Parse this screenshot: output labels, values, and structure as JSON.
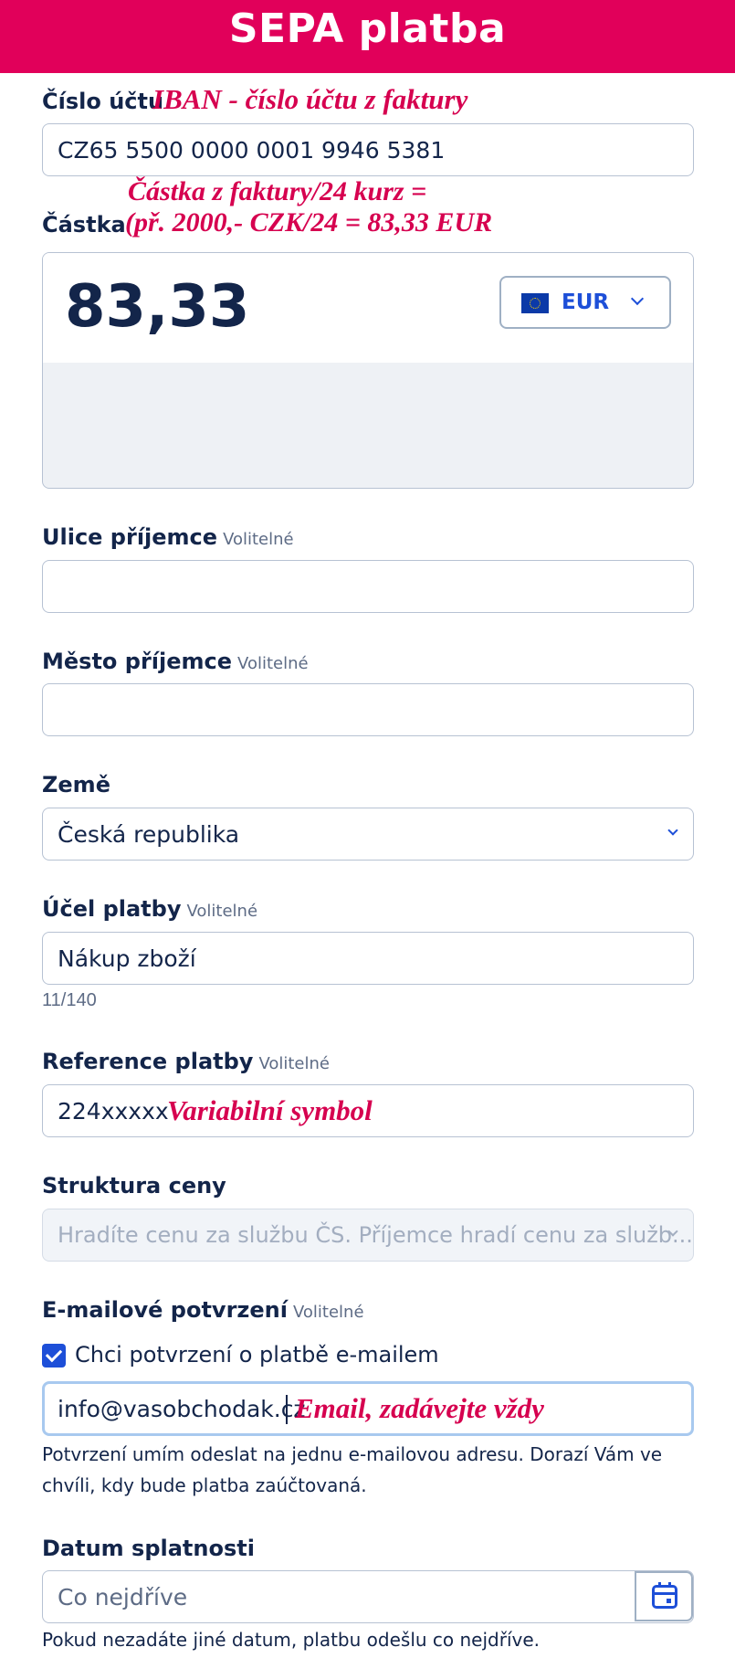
{
  "header": {
    "title": "SEPA platba"
  },
  "account": {
    "label": "Číslo účtu",
    "note": "IBAN - číslo účtu z faktury",
    "value": "CZ65 5500 0000 0001 9946 5381"
  },
  "amount": {
    "label": "Částka",
    "note_line1": "Částka z faktury/24 kurz =",
    "note_line2": "(př. 2000,- CZK/24 = 83,33 EUR",
    "value": "83,33",
    "currency": "EUR",
    "currency_icon": "eu-flag-icon"
  },
  "street": {
    "label": "Ulice příjemce",
    "optional": "Volitelné",
    "value": ""
  },
  "city": {
    "label": "Město příjemce",
    "optional": "Volitelné",
    "value": ""
  },
  "country": {
    "label": "Země",
    "value": "Česká republika"
  },
  "purpose": {
    "label": "Účel platby",
    "optional": "Volitelné",
    "value": "Nákup zboží",
    "counter": "11/140"
  },
  "reference": {
    "label": "Reference platby",
    "optional": "Volitelné",
    "value": "224xxxxx",
    "note": "Variabilní symbol"
  },
  "price_structure": {
    "label": "Struktura ceny",
    "value": "Hradíte cenu za službu ČS. Příjemce hradí cenu za služb..."
  },
  "email": {
    "label": "E-mailové potvrzení",
    "optional": "Volitelné",
    "checkbox_label": "Chci potvrzení o platbě e-mailem",
    "checked": true,
    "value": "info@vasobchodak.cz",
    "note": "Email, zadávejte vždy",
    "help_line1": "Potvrzení umím odeslat na jednu e-mailovou adresu. Dorazí Vám ve",
    "help_line2": "chvíli, kdy bude platba zaúčtovaná."
  },
  "due_date": {
    "label": "Datum splatnosti",
    "placeholder": "Co nejdříve",
    "help": "Pokud nezadáte jiné datum, platbu odešlu co nejdříve."
  },
  "colors": {
    "brand": "#e1005a",
    "accent": "#1d4fd8",
    "text": "#13254a",
    "annotation": "#d6004f"
  }
}
